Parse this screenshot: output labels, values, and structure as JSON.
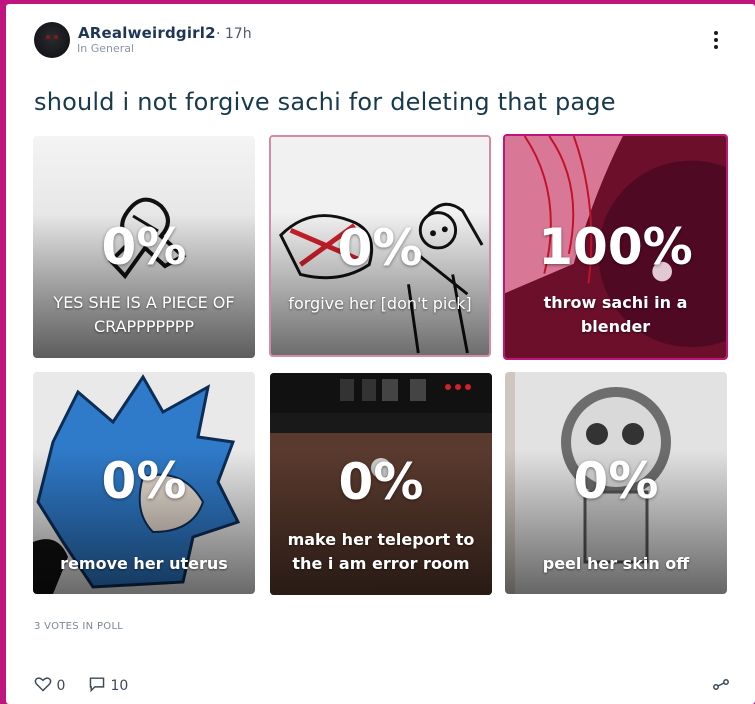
{
  "post": {
    "author": "ARealweirdgirl2",
    "time": "· 17h",
    "category": "In General",
    "title": "should i not forgive sachi for deleting that page"
  },
  "poll": {
    "options": [
      {
        "percent": "0%",
        "label": "YES SHE IS A PIECE OF CRAPPPPPPP",
        "selected": false
      },
      {
        "percent": "0%",
        "label": "forgive her [don't pick]",
        "selected": false
      },
      {
        "percent": "100%",
        "label": "throw sachi in a blender",
        "selected": true
      },
      {
        "percent": "0%",
        "label": "remove her uterus",
        "selected": false
      },
      {
        "percent": "0%",
        "label": "make her teleport to the i am error room",
        "selected": false
      },
      {
        "percent": "0%",
        "label": "peel her skin off",
        "selected": false
      }
    ],
    "votes_text": "3 VOTES IN POLL"
  },
  "footer": {
    "likes": "0",
    "comments": "10"
  },
  "colors": {
    "page_background": "#c0157f",
    "title_text": "#173a4c",
    "selected_border": "#c0157f"
  },
  "icons": [
    "more-icon",
    "heart-icon",
    "comment-icon",
    "share-icon"
  ]
}
